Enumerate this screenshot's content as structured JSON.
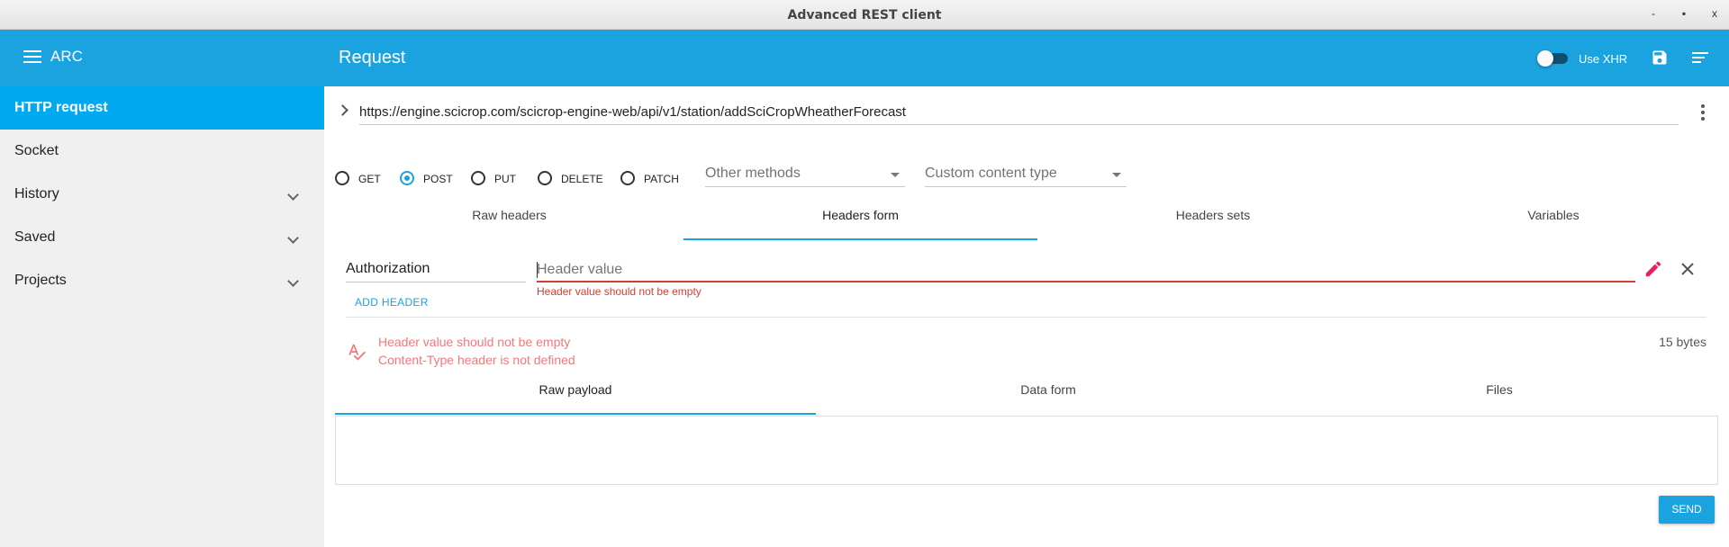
{
  "window": {
    "title": "Advanced REST client",
    "minimize": "-",
    "maximize": "▪",
    "close": "x"
  },
  "drawer": {
    "app_name": "ARC",
    "items": [
      {
        "label": "HTTP request",
        "active": true,
        "expandable": false
      },
      {
        "label": "Socket",
        "active": false,
        "expandable": false
      },
      {
        "label": "History",
        "active": false,
        "expandable": true
      },
      {
        "label": "Saved",
        "active": false,
        "expandable": true
      },
      {
        "label": "Projects",
        "active": false,
        "expandable": true
      }
    ]
  },
  "appbar": {
    "title": "Request",
    "use_xhr_label": "Use XHR",
    "use_xhr_enabled": false
  },
  "request": {
    "url": "https://engine.scicrop.com/scicrop-engine-web/api/v1/station/addSciCropWheatherForecast",
    "methods": [
      {
        "label": "GET",
        "checked": false
      },
      {
        "label": "POST",
        "checked": true
      },
      {
        "label": "PUT",
        "checked": false
      },
      {
        "label": "DELETE",
        "checked": false
      },
      {
        "label": "PATCH",
        "checked": false
      }
    ],
    "other_methods_label": "Other methods",
    "content_type_label": "Custom content type"
  },
  "header_tabs": [
    {
      "label": "Raw headers",
      "active": false
    },
    {
      "label": "Headers form",
      "active": true
    },
    {
      "label": "Headers sets",
      "active": false
    },
    {
      "label": "Variables",
      "active": false
    }
  ],
  "headers_form": {
    "name": "Authorization",
    "value": "",
    "value_placeholder": "Header value",
    "value_error": "Header value should not be empty",
    "add_header_label": "ADD HEADER"
  },
  "warnings": [
    "Header value should not be empty",
    "Content-Type header is not defined"
  ],
  "payload_size": "15 bytes",
  "body_tabs": [
    {
      "label": "Raw payload",
      "active": true
    },
    {
      "label": "Data form",
      "active": false
    },
    {
      "label": "Files",
      "active": false
    }
  ],
  "send_label": "SEND",
  "colors": {
    "primary": "#1ba3e0",
    "active_nav": "#00a9f0",
    "error": "#d23f31",
    "warning_text": "#f37878",
    "edit_icon": "#e91e63"
  }
}
